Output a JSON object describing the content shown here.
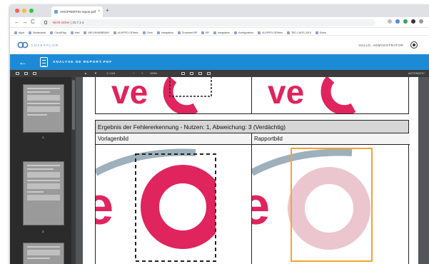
{
  "browser": {
    "tab_title": "AHGFRERTIO.report.pdf",
    "tab_close": "×",
    "new_tab": "+",
    "nav_back": "←",
    "nav_forward": "→",
    "nav_reload": "C",
    "url_prefix": "Nicht sicher",
    "url_host": "10.7.1.4"
  },
  "bookmarks": [
    "Apps",
    "Bookmarks",
    "CloudFlag",
    "Intel",
    "ARCHIVARBRAIN",
    "ALVIPPO-OFilters",
    "Crew",
    "Integration",
    "Druckdrei BP",
    "BP",
    "Integration",
    "Konfiguration",
    "ALVIPPO-OFilters",
    "TBC-CAGS-2019",
    "Eulen"
  ],
  "app": {
    "logo_text": "LUXEXPLOR",
    "user_label": "HALLO, ADMINISTRATOR",
    "report_title": "ANALYSE DE REPORT.PDF"
  },
  "toolbar": {
    "page_info": "1 / 116",
    "zoom": "100%",
    "right_label": "AUTOMATIC"
  },
  "thumbnails": [
    {
      "page": "1"
    },
    {
      "page": "2"
    },
    {
      "page": "3"
    }
  ],
  "report": {
    "result_header": "Ergebnis der Fehlererkennung - Nutzen: 1, Abweichung: 3 (Verdächtig)",
    "col_reference": "Vorlagenbild",
    "col_report": "Rapportbild"
  },
  "colors": {
    "accent_blue": "#1d8ad6",
    "brand_magenta": "#e0245e",
    "highlight_orange": "#f3a336",
    "muted_pink": "#ebc6cf",
    "grey_arc": "#9eb0bc"
  }
}
